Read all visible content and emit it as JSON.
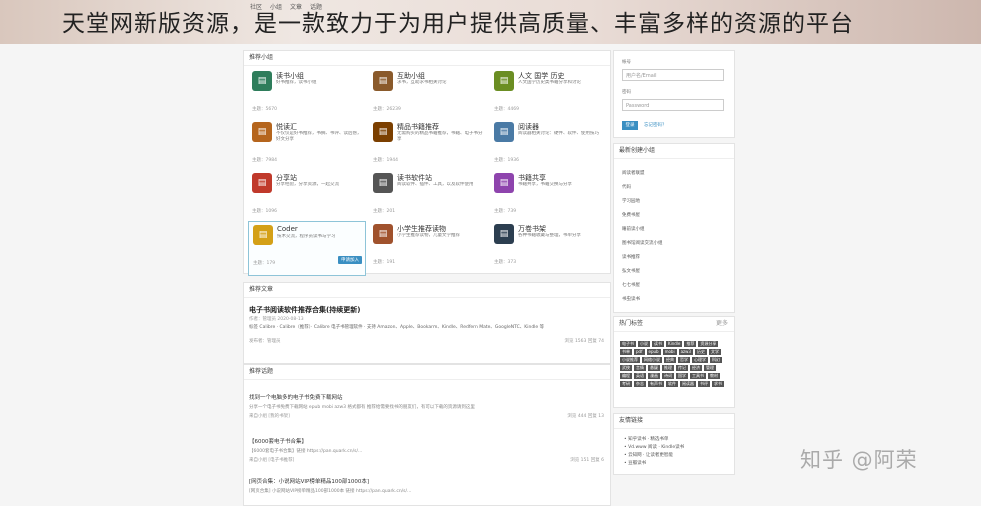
{
  "nav": [
    "社区",
    "小组",
    "文章",
    "话题"
  ],
  "banner": "天堂网新版资源，是一款致力于为用户提供高质量、丰富多样的资源的平台",
  "watermark": "知乎 @阿荣",
  "forums_header": "推荐小组",
  "forums": [
    {
      "name": "读书小组",
      "desc": "好书推荐，读书小组",
      "stats": "主题：5670",
      "icon": "book-icon",
      "color": "#2e7d5b"
    },
    {
      "name": "互助小组",
      "desc": "求书，互助求书相关讨论",
      "stats": "主题：26239",
      "icon": "help-icon",
      "color": "#8a5a2b"
    },
    {
      "name": "人文 国学 历史",
      "desc": "人文国学历史类书籍分享和讨论",
      "stats": "主题：4469",
      "icon": "history-icon",
      "color": "#6b8e23"
    },
    {
      "name": "悦读汇",
      "desc": "不仅仅是好书推荐，书摘、书评、读后感，好文分享",
      "stats": "主题：7984",
      "icon": "readers-icon",
      "color": "#b5651d"
    },
    {
      "name": "精品书籍推荐",
      "desc": "无需购买的精品书籍推荐，书籍、电子书分享",
      "stats": "主题：1944",
      "icon": "premium-book-icon",
      "color": "#7b3f00"
    },
    {
      "name": "阅读器",
      "desc": "阅读器相关讨论：硬件、软件、使用技巧",
      "stats": "主题：1936",
      "icon": "reader-device-icon",
      "color": "#4a7aa5"
    },
    {
      "name": "分享站",
      "desc": "分享经验，分享资源，一起交流",
      "stats": "主题：1096",
      "icon": "share-icon",
      "color": "#c0392b"
    },
    {
      "name": "读书软件站",
      "desc": "阅读软件、插件、工具，以及软件使用",
      "stats": "主题：201",
      "icon": "software-icon",
      "color": "#555555"
    },
    {
      "name": "书籍共享",
      "desc": "书籍共享，书籍交换与分享",
      "stats": "主题：739",
      "icon": "exchange-icon",
      "color": "#8e44ad"
    },
    {
      "name": "Coder",
      "desc": "技术交流，程序员读书与学习",
      "stats": "主题：179",
      "icon": "coder-icon",
      "color": "#d4a017",
      "selected": true,
      "join": "申请加入"
    },
    {
      "name": "小学生推荐读物",
      "desc": "小学生推荐读物，儿童文学推荐",
      "stats": "主题：191",
      "icon": "kids-book-icon",
      "color": "#a0522d"
    },
    {
      "name": "万卷书架",
      "desc": "各种书籍收藏与整理，书单分享",
      "stats": "主题：373",
      "icon": "bookshelf-icon",
      "color": "#2c3e50"
    }
  ],
  "article": {
    "header": "推荐文章",
    "title": "电子书阅读软件推荐合集(持续更新)",
    "meta": "作者：管理员  2020-08-13",
    "excerpt": "标签 Calibre · Calibre（推荐）· Calibre 电子书管理软件 · 支持 Amazon、Apple、Bookarm、Kindle、Redfern Mate、GoogleNTC、Kindle 等",
    "author": "发布者：管理员",
    "stats": "浏览 1563  回复 74"
  },
  "threads_header": "推荐话题",
  "threads": [
    {
      "title": "找到一个电脑多的电子书免费下载网站",
      "text": "分享一个电子书免费下载网站 epub mobi azw3 格式都有 推荐给需要找书的朋友们，有可以下载的资源请到这里",
      "meta": "来自小组 [我的书架]",
      "stat": "浏览 444  回复 13"
    },
    {
      "title": "【6000套电子书合集】",
      "text": "【6000套电子书合集】链接 https://pan.quark.cn/s/...",
      "meta": "来自小组 [电子书推荐]",
      "stat": "浏览 151  回复 6"
    },
    {
      "title": "[网页合集：小说网站VIP榜单精品100部1000本]",
      "text": "[网页合集] 小说网站VIP榜单精品100部1000本 链接 https://pan.quark.cn/s/...",
      "meta": "",
      "stat": ""
    }
  ],
  "login": {
    "account_label": "帐号",
    "account_placeholder": "用户名/Email",
    "password_label": "密码",
    "password_placeholder": "Password",
    "submit": "登录",
    "forgot": "忘记密码？"
  },
  "recent_groups": {
    "header": "最新创建小组",
    "items": [
      "阅读者联盟",
      "代码",
      "学习园地",
      "免费书屋",
      "睡前读小组",
      "图书馆阅读交流小组",
      "读书推荐",
      "弘文书屋",
      "七七书屋",
      "书虫读书"
    ]
  },
  "hot_tags": {
    "header": "热门标签",
    "more": "更多",
    "items": [
      "电子书",
      "小说",
      "读书",
      "Kindle",
      "推荐",
      "资源分享",
      "书单",
      "pdf",
      "epub",
      "mobi",
      "azw3",
      "历史",
      "文学",
      "小说推荐",
      "网络小说",
      "经典",
      "哲学",
      "心理学",
      "科幻",
      "武侠",
      "言情",
      "悬疑",
      "推理",
      "传记",
      "经济",
      "管理",
      "编程",
      "英语",
      "漫画",
      "诗词",
      "国学",
      "工具书",
      "教材",
      "考研",
      "杂志",
      "有声书",
      "软件",
      "阅读器",
      "书评",
      "求书"
    ]
  },
  "links": {
    "header": "友情链接",
    "items": [
      "知乎读书 · 精选书单",
      "Vd.www 阅读 · Kindle读书",
      "云知网 · 让读者更智能",
      "豆瓣读书"
    ]
  }
}
